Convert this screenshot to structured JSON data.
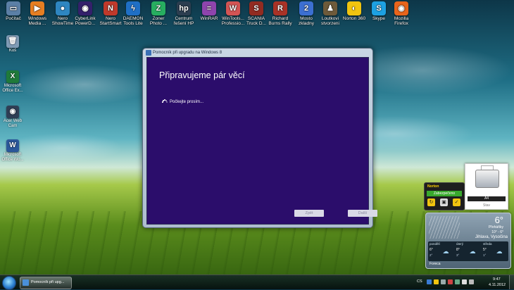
{
  "desktop_icons": [
    {
      "label": "Počítač",
      "icon": "computer-icon",
      "color": "#5b7fa6",
      "glyph": "▭"
    },
    {
      "label": "Windows Media ...",
      "icon": "windows-media-icon",
      "color": "#e67e22",
      "glyph": "▶"
    },
    {
      "label": "Nero ShowTime",
      "icon": "nero-showtime-icon",
      "color": "#2e86c1",
      "glyph": "●"
    },
    {
      "label": "CyberLink PowerD...",
      "icon": "cyberlink-icon",
      "color": "#34206b",
      "glyph": "◉"
    },
    {
      "label": "Nero StartSmart",
      "icon": "nero-startsmart-icon",
      "color": "#c0392b",
      "glyph": "N"
    },
    {
      "label": "DAEMON Tools Lite",
      "icon": "daemon-tools-icon",
      "color": "#1f6fc5",
      "glyph": "ϟ"
    },
    {
      "label": "Zoner Photo ...",
      "icon": "zoner-photo-icon",
      "color": "#27ae60",
      "glyph": "Z"
    },
    {
      "label": "Centrum řešení HP",
      "icon": "hp-center-icon",
      "color": "#2c3e50",
      "glyph": "hp"
    },
    {
      "label": "WinRAR",
      "icon": "winrar-icon",
      "color": "#8e44ad",
      "glyph": "≡"
    },
    {
      "label": "WinTools... Professio...",
      "icon": "wintools-icon",
      "color": "#d35454",
      "glyph": "W"
    },
    {
      "label": "SCANIA Truck D...",
      "icon": "scania-icon",
      "color": "#922b21",
      "glyph": "S"
    },
    {
      "label": "Richard Burns Rally",
      "icon": "rally-icon",
      "color": "#a93226",
      "glyph": "R"
    },
    {
      "label": "Mosto zkladny",
      "icon": "mosto-icon",
      "color": "#3c6fd1",
      "glyph": "2"
    },
    {
      "label": "Loutkovi stvorzeni",
      "icon": "loutkovi-icon",
      "color": "#6e5a3a",
      "glyph": "♟"
    },
    {
      "label": "Norton 360",
      "icon": "norton-icon",
      "color": "#f1c40f",
      "glyph": "◐"
    },
    {
      "label": "Skype",
      "icon": "skype-icon",
      "color": "#1da1e2",
      "glyph": "S"
    },
    {
      "label": "Mozilla Firefox",
      "icon": "firefox-icon",
      "color": "#e8641b",
      "glyph": "◉"
    }
  ],
  "side_icons": [
    {
      "label": "Koš",
      "icon": "recycle-bin-icon",
      "color": "#7f9bb5",
      "glyph": "🗑"
    },
    {
      "label": "Microsoft Office Ex...",
      "icon": "excel-icon",
      "color": "#1f7a3a",
      "glyph": "X"
    },
    {
      "label": "Acer Web Cam",
      "icon": "webcam-icon",
      "color": "#2f3e55",
      "glyph": "◉"
    },
    {
      "label": "Microsoft Office Wo...",
      "icon": "word-icon",
      "color": "#2b579a",
      "glyph": "W"
    }
  ],
  "window": {
    "title": "Pomocník při upgradu na Windows 8",
    "heading": "Připravujeme pár věcí",
    "status": "Počkejte prosím...",
    "back_label": "Zpět",
    "next_label": "Další",
    "bg_color": "#2b0d6b"
  },
  "norton_gadget": {
    "logo": "Norton",
    "status": "Zabezpečeno"
  },
  "printer_gadget": {
    "paper": "A4",
    "label": "Stav"
  },
  "weather": {
    "temp": "6°",
    "condition": "Přeháňky",
    "range": "10° - 6°",
    "location": "Jihlava, Vysočina",
    "days": [
      {
        "name": "pondělí",
        "hi": "6°",
        "lo": "2°"
      },
      {
        "name": "úterý",
        "hi": "8°",
        "lo": "3°"
      },
      {
        "name": "středa",
        "hi": "5°",
        "lo": "1°"
      }
    ],
    "provider": "Foreca"
  },
  "taskbar": {
    "task_label": "Pomocník při upg...",
    "language": "CS",
    "time": "9:47",
    "date": "4.11.2012"
  }
}
